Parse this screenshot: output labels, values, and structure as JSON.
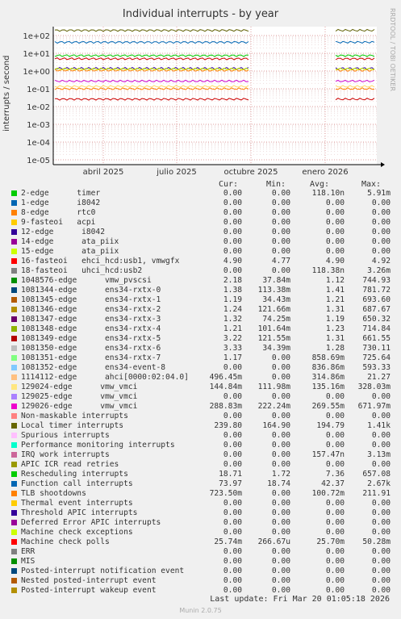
{
  "title": "Individual interrupts - by year",
  "side_label": "RRDTOOL / TOBI OETIKER",
  "ylabel": "interrupts / second",
  "footer": {
    "update": "Last update: Fri Mar 20 01:05:18 2026",
    "munin": "Munin 2.0.75"
  },
  "headers": {
    "cur": "Cur:",
    "min": "Min:",
    "avg": "Avg:",
    "max": "Max:"
  },
  "chart_data": {
    "type": "line",
    "title": "Individual interrupts - by year",
    "ylabel": "interrupts / second",
    "yscale": "log",
    "ylim": [
      1e-05,
      300
    ],
    "y_ticks": [
      "1e+02",
      "1e+01",
      "1e+00",
      "1e-01",
      "1e-02",
      "1e-03",
      "1e-04",
      "1e-05"
    ],
    "x_ticks": [
      "abril 2025",
      "julio 2025",
      "octubre 2025",
      "enero 2026"
    ],
    "grid": true,
    "approx_levels": [
      {
        "name": "Local timer interrupts",
        "color": "#5e5e00",
        "value": 195
      },
      {
        "name": "Function call interrupts",
        "color": "#0066b3",
        "value": 42
      },
      {
        "name": "Rescheduling interrupts",
        "color": "#00cc00",
        "value": 7.4
      },
      {
        "name": "16-fasteoi ehci_hcd:usb1, vmwgfx",
        "color": "#cc0000",
        "value": 4.9
      },
      {
        "name": "1048576-edge vmw_pvscsi",
        "color": "#ff8000",
        "value": 1.1
      },
      {
        "name": "1081344-edge ens34-rxtx-0",
        "color": "#330099",
        "value": 1.4
      },
      {
        "name": "1081349-edge ens34-rxtx-5",
        "color": "#ccff00",
        "value": 1.3
      },
      {
        "name": "129026-edge vmw_vmci",
        "color": "#cc00cc",
        "value": 0.27
      },
      {
        "name": "129024-edge vmw_vmci",
        "color": "#ffd966",
        "value": 0.135
      },
      {
        "name": "TLB shootdowns",
        "color": "#ff8000",
        "value": 0.1
      },
      {
        "name": "Machine check polls",
        "color": "#cc0000",
        "value": 0.026
      }
    ]
  },
  "legend": [
    {
      "name": "2-edge      timer",
      "color": "#00cc00",
      "cur": "0.00",
      "min": "0.00",
      "avg": "118.10n",
      "max": "5.91m"
    },
    {
      "name": "1-edge      i8042",
      "color": "#0066b3",
      "cur": "0.00",
      "min": "0.00",
      "avg": "0.00",
      "max": "0.00"
    },
    {
      "name": "8-edge      rtc0",
      "color": "#ff8000",
      "cur": "0.00",
      "min": "0.00",
      "avg": "0.00",
      "max": "0.00"
    },
    {
      "name": "9-fasteoi   acpi",
      "color": "#ffcc00",
      "cur": "0.00",
      "min": "0.00",
      "avg": "0.00",
      "max": "0.00"
    },
    {
      "name": "12-edge      i8042",
      "color": "#330099",
      "cur": "0.00",
      "min": "0.00",
      "avg": "0.00",
      "max": "0.00"
    },
    {
      "name": "14-edge      ata_piix",
      "color": "#990099",
      "cur": "0.00",
      "min": "0.00",
      "avg": "0.00",
      "max": "0.00"
    },
    {
      "name": "15-edge      ata_piix",
      "color": "#ccff00",
      "cur": "0.00",
      "min": "0.00",
      "avg": "0.00",
      "max": "0.00"
    },
    {
      "name": "16-fasteoi   ehci_hcd:usb1, vmwgfx",
      "color": "#ff0000",
      "cur": "4.90",
      "min": "4.77",
      "avg": "4.90",
      "max": "4.92"
    },
    {
      "name": "18-fasteoi   uhci_hcd:usb2",
      "color": "#808080",
      "cur": "0.00",
      "min": "0.00",
      "avg": "118.38n",
      "max": "3.26m"
    },
    {
      "name": "1048576-edge      vmw_pvscsi",
      "color": "#008f00",
      "cur": "2.18",
      "min": "37.84m",
      "avg": "1.12",
      "max": "744.93"
    },
    {
      "name": "1081344-edge      ens34-rxtx-0",
      "color": "#00487d",
      "cur": "1.38",
      "min": "113.38m",
      "avg": "1.41",
      "max": "781.72"
    },
    {
      "name": "1081345-edge      ens34-rxtx-1",
      "color": "#b35a00",
      "cur": "1.19",
      "min": "34.43m",
      "avg": "1.21",
      "max": "693.60"
    },
    {
      "name": "1081346-edge      ens34-rxtx-2",
      "color": "#b38f00",
      "cur": "1.24",
      "min": "121.66m",
      "avg": "1.31",
      "max": "687.67"
    },
    {
      "name": "1081347-edge      ens34-rxtx-3",
      "color": "#6b006b",
      "cur": "1.32",
      "min": "74.25m",
      "avg": "1.19",
      "max": "650.32"
    },
    {
      "name": "1081348-edge      ens34-rxtx-4",
      "color": "#8fb300",
      "cur": "1.21",
      "min": "101.64m",
      "avg": "1.23",
      "max": "714.84"
    },
    {
      "name": "1081349-edge      ens34-rxtx-5",
      "color": "#b30000",
      "cur": "3.22",
      "min": "121.55m",
      "avg": "1.31",
      "max": "661.55"
    },
    {
      "name": "1081350-edge      ens34-rxtx-6",
      "color": "#bebebe",
      "cur": "3.33",
      "min": "34.39m",
      "avg": "1.28",
      "max": "730.11"
    },
    {
      "name": "1081351-edge      ens34-rxtx-7",
      "color": "#80ff80",
      "cur": "1.17",
      "min": "0.00",
      "avg": "858.69m",
      "max": "725.64"
    },
    {
      "name": "1081352-edge      ens34-event-8",
      "color": "#80c9ff",
      "cur": "0.00",
      "min": "0.00",
      "avg": "836.86m",
      "max": "593.33"
    },
    {
      "name": "1114112-edge      ahci[0000:02:04.0]",
      "color": "#ffc080",
      "cur": "496.45m",
      "min": "0.00",
      "avg": "314.86m",
      "max": "21.27"
    },
    {
      "name": "129024-edge      vmw_vmci",
      "color": "#ffe680",
      "cur": "144.84m",
      "min": "111.98m",
      "avg": "135.16m",
      "max": "328.03m"
    },
    {
      "name": "129025-edge      vmw_vmci",
      "color": "#aa80ff",
      "cur": "0.00",
      "min": "0.00",
      "avg": "0.00",
      "max": "0.00"
    },
    {
      "name": "129026-edge      vmw_vmci",
      "color": "#ee00cc",
      "cur": "288.83m",
      "min": "222.24m",
      "avg": "269.55m",
      "max": "671.97m"
    },
    {
      "name": "Non-maskable interrupts",
      "color": "#ff8080",
      "cur": "0.00",
      "min": "0.00",
      "avg": "0.00",
      "max": "0.00"
    },
    {
      "name": "Local timer interrupts",
      "color": "#666600",
      "cur": "239.80",
      "min": "164.90",
      "avg": "194.79",
      "max": "1.41k"
    },
    {
      "name": "Spurious interrupts",
      "color": "#ffbfff",
      "cur": "0.00",
      "min": "0.00",
      "avg": "0.00",
      "max": "0.00"
    },
    {
      "name": "Performance monitoring interrupts",
      "color": "#00ffcc",
      "cur": "0.00",
      "min": "0.00",
      "avg": "0.00",
      "max": "0.00"
    },
    {
      "name": "IRQ work interrupts",
      "color": "#cc6699",
      "cur": "0.00",
      "min": "0.00",
      "avg": "157.47n",
      "max": "3.13m"
    },
    {
      "name": "APIC ICR read retries",
      "color": "#999900",
      "cur": "0.00",
      "min": "0.00",
      "avg": "0.00",
      "max": "0.00"
    },
    {
      "name": "Rescheduling interrupts",
      "color": "#00cc00",
      "cur": "18.71",
      "min": "1.72",
      "avg": "7.36",
      "max": "657.08"
    },
    {
      "name": "Function call interrupts",
      "color": "#0066b3",
      "cur": "73.97",
      "min": "18.74",
      "avg": "42.37",
      "max": "2.67k"
    },
    {
      "name": "TLB shootdowns",
      "color": "#ff8000",
      "cur": "723.50m",
      "min": "0.00",
      "avg": "100.72m",
      "max": "211.91"
    },
    {
      "name": "Thermal event interrupts",
      "color": "#ffcc00",
      "cur": "0.00",
      "min": "0.00",
      "avg": "0.00",
      "max": "0.00"
    },
    {
      "name": "Threshold APIC interrupts",
      "color": "#330099",
      "cur": "0.00",
      "min": "0.00",
      "avg": "0.00",
      "max": "0.00"
    },
    {
      "name": "Deferred Error APIC interrupts",
      "color": "#990099",
      "cur": "0.00",
      "min": "0.00",
      "avg": "0.00",
      "max": "0.00"
    },
    {
      "name": "Machine check exceptions",
      "color": "#ccff00",
      "cur": "0.00",
      "min": "0.00",
      "avg": "0.00",
      "max": "0.00"
    },
    {
      "name": "Machine check polls",
      "color": "#ff0000",
      "cur": "25.74m",
      "min": "266.67u",
      "avg": "25.70m",
      "max": "50.28m"
    },
    {
      "name": "ERR",
      "color": "#808080",
      "cur": "0.00",
      "min": "0.00",
      "avg": "0.00",
      "max": "0.00"
    },
    {
      "name": "MIS",
      "color": "#008f00",
      "cur": "0.00",
      "min": "0.00",
      "avg": "0.00",
      "max": "0.00"
    },
    {
      "name": "Posted-interrupt notification event",
      "color": "#00487d",
      "cur": "0.00",
      "min": "0.00",
      "avg": "0.00",
      "max": "0.00"
    },
    {
      "name": "Nested posted-interrupt event",
      "color": "#b35a00",
      "cur": "0.00",
      "min": "0.00",
      "avg": "0.00",
      "max": "0.00"
    },
    {
      "name": "Posted-interrupt wakeup event",
      "color": "#b38f00",
      "cur": "0.00",
      "min": "0.00",
      "avg": "0.00",
      "max": "0.00"
    }
  ]
}
